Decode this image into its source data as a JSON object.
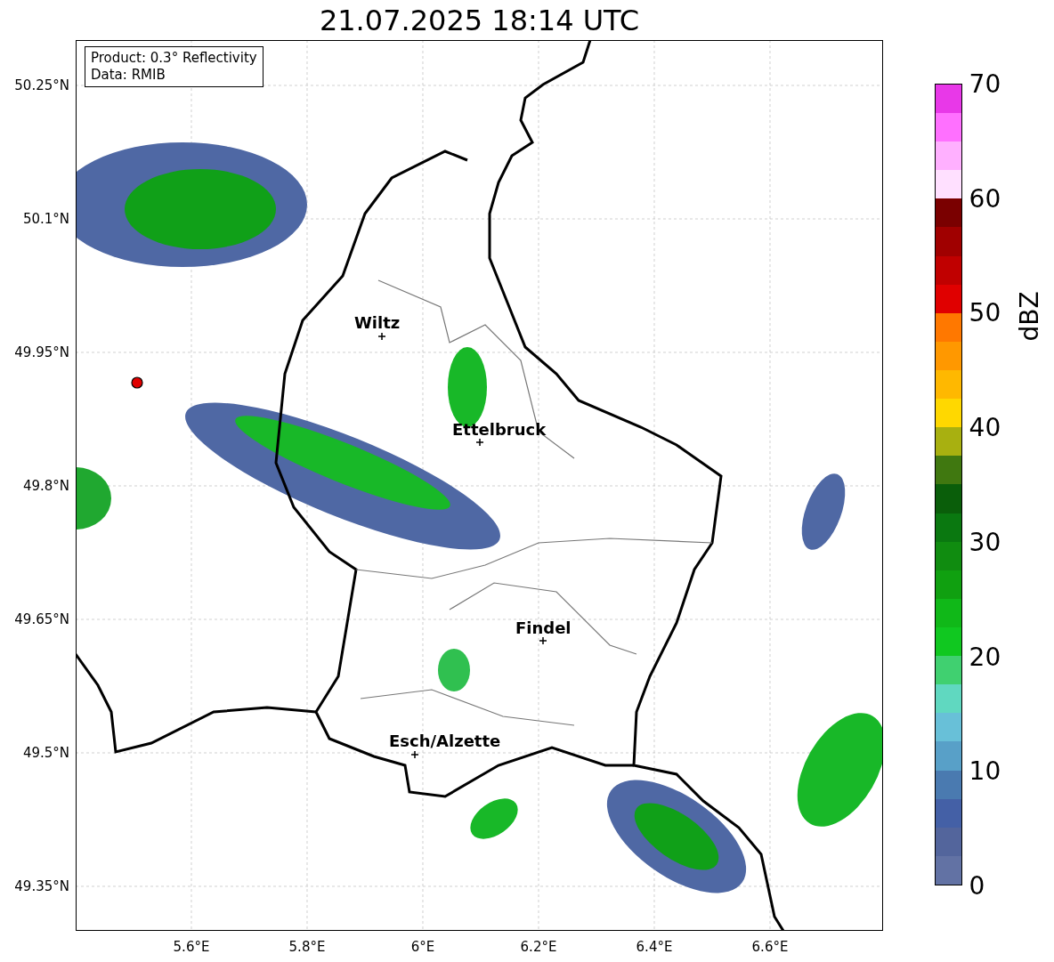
{
  "title": "21.07.2025 18:14 UTC",
  "info_box": {
    "lines": [
      "Product: 0.3° Reflectivity",
      "Data: RMIB"
    ]
  },
  "map": {
    "places": [
      {
        "name": "Wiltz"
      },
      {
        "name": "Ettelbruck"
      },
      {
        "name": "Findel"
      },
      {
        "name": "Esch/Alzette"
      }
    ]
  },
  "y_axis": {
    "ticks": [
      "50.25°N",
      "50.1°N",
      "49.95°N",
      "49.8°N",
      "49.65°N",
      "49.5°N",
      "49.35°N"
    ]
  },
  "x_axis": {
    "ticks": [
      "5.6°E",
      "5.8°E",
      "6°E",
      "6.2°E",
      "6.4°E",
      "6.6°E"
    ]
  },
  "colorbar": {
    "label": "dBZ",
    "ticks": [
      "70",
      "60",
      "50",
      "40",
      "30",
      "20",
      "10",
      "0"
    ],
    "bands": [
      {
        "color": "#6272a4"
      },
      {
        "color": "#53659c"
      },
      {
        "color": "#4460a6"
      },
      {
        "color": "#4a7ab0"
      },
      {
        "color": "#58a0c8"
      },
      {
        "color": "#68c0d8"
      },
      {
        "color": "#60d8c0"
      },
      {
        "color": "#40d070"
      },
      {
        "color": "#10c820"
      },
      {
        "color": "#10b818"
      },
      {
        "color": "#10a010"
      },
      {
        "color": "#108c10"
      },
      {
        "color": "#0a7810"
      },
      {
        "color": "#0a5e0a"
      },
      {
        "color": "#407810"
      },
      {
        "color": "#a8b010"
      },
      {
        "color": "#ffd800"
      },
      {
        "color": "#ffb800"
      },
      {
        "color": "#ff9800"
      },
      {
        "color": "#ff7800"
      },
      {
        "color": "#e00000"
      },
      {
        "color": "#c00000"
      },
      {
        "color": "#a00000"
      },
      {
        "color": "#7a0000"
      },
      {
        "color": "#ffe0ff"
      },
      {
        "color": "#ffb0ff"
      },
      {
        "color": "#ff70ff"
      },
      {
        "color": "#e838e8"
      }
    ]
  }
}
